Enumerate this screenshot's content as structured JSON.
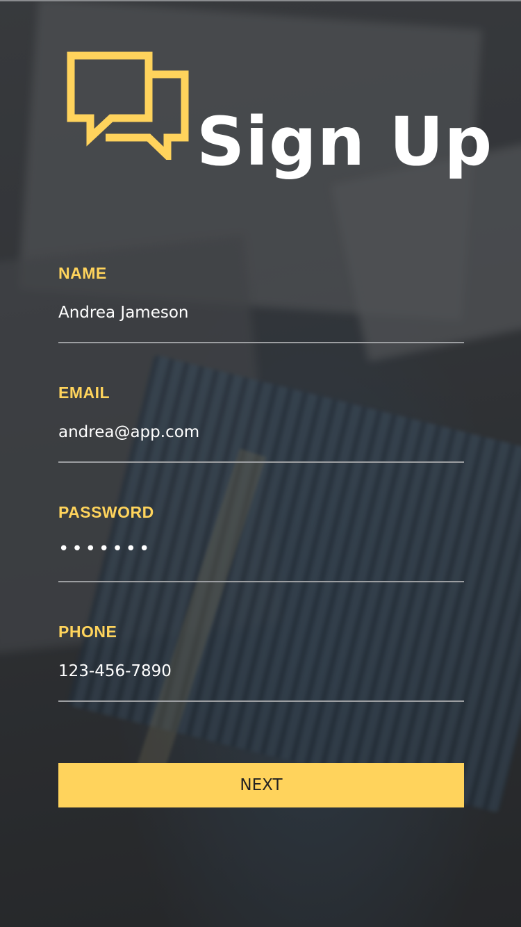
{
  "header": {
    "title": "Sign Up",
    "logo_icon": "chat-bubbles-icon",
    "accent_color": "#FFD35C"
  },
  "form": {
    "name": {
      "label": "NAME",
      "value": "Andrea Jameson"
    },
    "email": {
      "label": "EMAIL",
      "value": "andrea@app.com"
    },
    "password": {
      "label": "PASSWORD",
      "value": "•••••••"
    },
    "phone": {
      "label": "PHONE",
      "value": "123-456-7890"
    }
  },
  "actions": {
    "next_label": "NEXT"
  }
}
